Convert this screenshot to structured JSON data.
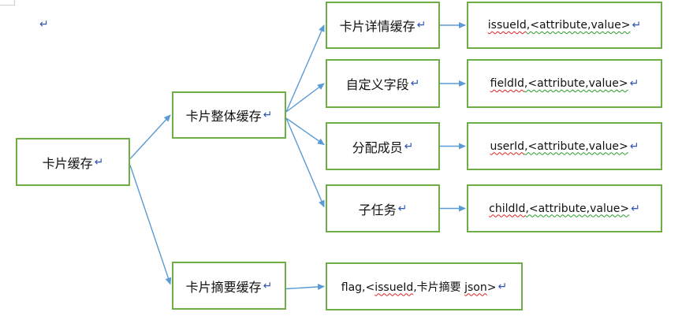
{
  "diagram": {
    "nodes": {
      "root": {
        "label": "卡片缓存"
      },
      "whole": {
        "label": "卡片整体缓存"
      },
      "summary": {
        "label": "卡片摘要缓存"
      },
      "detail": {
        "label": "卡片详情缓存"
      },
      "custom": {
        "label": "自定义字段"
      },
      "members": {
        "label": "分配成员"
      },
      "subtask": {
        "label": "子任务"
      },
      "detail_kv": {
        "key": "issueId",
        "rest": ",<attribute,value>"
      },
      "custom_kv": {
        "key": "fieldId",
        "rest": ",<attribute,value>"
      },
      "members_kv": {
        "key": "userId",
        "rest": ",<attribute,value>"
      },
      "subtask_kv": {
        "key": "childId",
        "rest": ",<attribute,value>"
      },
      "summary_kv": {
        "prefix": "flag,<",
        "key": "issueId",
        "mid": ",卡片摘要 ",
        "json": "json",
        "suffix": ">"
      }
    },
    "return_mark": "↵",
    "edges": [
      [
        "root",
        "whole"
      ],
      [
        "root",
        "summary"
      ],
      [
        "whole",
        "detail"
      ],
      [
        "whole",
        "custom"
      ],
      [
        "whole",
        "members"
      ],
      [
        "whole",
        "subtask"
      ],
      [
        "detail",
        "detail_kv"
      ],
      [
        "custom",
        "custom_kv"
      ],
      [
        "members",
        "members_kv"
      ],
      [
        "subtask",
        "subtask_kv"
      ],
      [
        "summary",
        "summary_kv"
      ]
    ],
    "colors": {
      "box_border": "#6fad47",
      "arrow": "#5b9bd5",
      "return_mark": "#2f55b5"
    }
  }
}
